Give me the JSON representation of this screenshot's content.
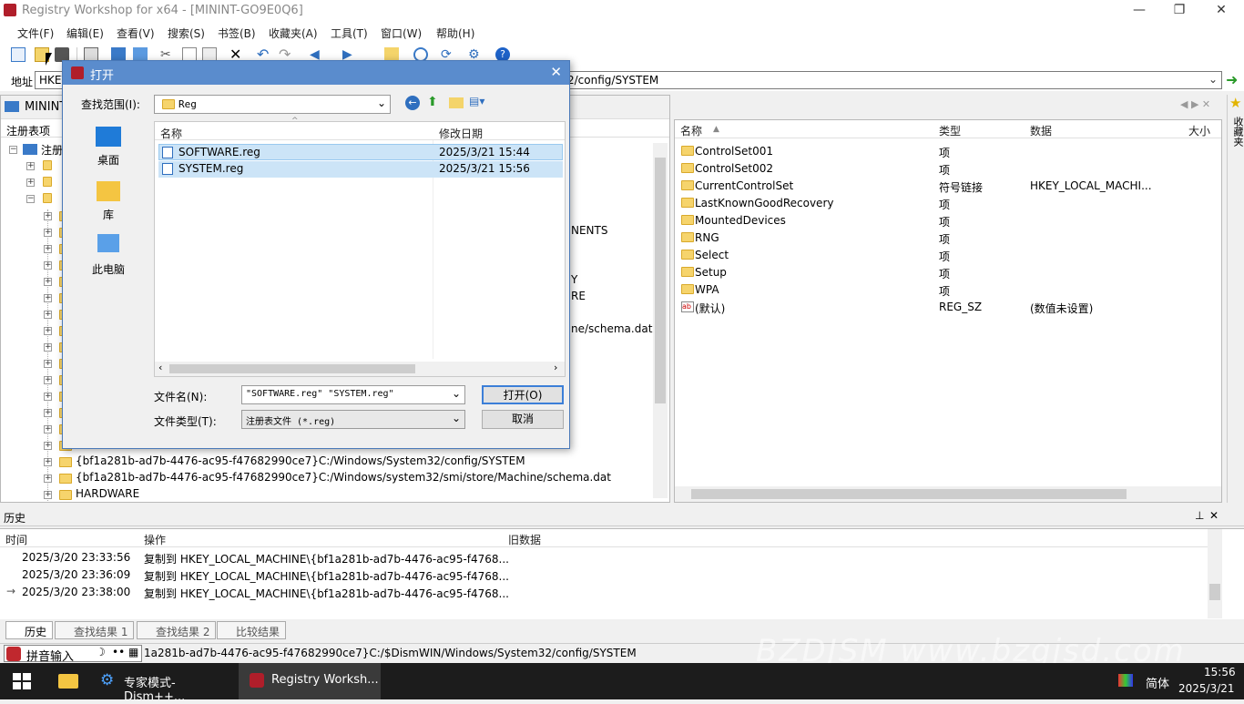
{
  "window": {
    "title": "Registry Workshop for x64 - [MININT-GO9E0Q6]",
    "min": "—",
    "max": "❐",
    "close": "✕"
  },
  "menu": [
    "文件(F)",
    "编辑(E)",
    "查看(V)",
    "搜索(S)",
    "书签(B)",
    "收藏夹(A)",
    "工具(T)",
    "窗口(W)",
    "帮助(H)"
  ],
  "address": {
    "label": "地址",
    "value_start": "HKEY",
    "value_end": "2/config/SYSTEM"
  },
  "left_pane": {
    "tab": "MININT",
    "col_header": "注册表项",
    "root_label": "注册",
    "partial_texts": [
      "NENTS",
      "Y",
      "RE",
      "ne/schema.dat"
    ],
    "rows": [
      "{bf1a281b-ad7b-4476-ac95-f47682990ce7}C:/Windows/System32/config/SYSTEM",
      "{bf1a281b-ad7b-4476-ac95-f47682990ce7}C:/Windows/system32/smi/store/Machine/schema.dat",
      "HARDWARE"
    ]
  },
  "right_pane": {
    "columns": [
      "名称",
      "类型",
      "数据",
      "大小"
    ],
    "rows": [
      {
        "name": "ControlSet001",
        "type": "项",
        "data": ""
      },
      {
        "name": "ControlSet002",
        "type": "项",
        "data": ""
      },
      {
        "name": "CurrentControlSet",
        "type": "符号链接",
        "data": "HKEY_LOCAL_MACHI..."
      },
      {
        "name": "LastKnownGoodRecovery",
        "type": "项",
        "data": ""
      },
      {
        "name": "MountedDevices",
        "type": "项",
        "data": ""
      },
      {
        "name": "RNG",
        "type": "项",
        "data": ""
      },
      {
        "name": "Select",
        "type": "项",
        "data": ""
      },
      {
        "name": "Setup",
        "type": "项",
        "data": ""
      },
      {
        "name": "WPA",
        "type": "项",
        "data": ""
      },
      {
        "name": "(默认)",
        "type": "REG_SZ",
        "data": "(数值未设置)"
      }
    ],
    "fav_label": "收藏夹"
  },
  "history": {
    "title": "历史",
    "columns": [
      "时间",
      "操作",
      "旧数据"
    ],
    "rows": [
      {
        "time": "2025/3/20 23:33:56",
        "op": "复制到 HKEY_LOCAL_MACHINE\\{bf1a281b-ad7b-4476-ac95-f4768..."
      },
      {
        "time": "2025/3/20 23:36:09",
        "op": "复制到 HKEY_LOCAL_MACHINE\\{bf1a281b-ad7b-4476-ac95-f4768..."
      },
      {
        "time": "2025/3/20 23:38:00",
        "op": "复制到 HKEY_LOCAL_MACHINE\\{bf1a281b-ad7b-4476-ac95-f4768..."
      }
    ]
  },
  "bottom_tabs": [
    "历史",
    "查找结果 1",
    "查找结果 2",
    "比较结果"
  ],
  "status": {
    "ime": "拼音输入",
    "path": "1a281b-ad7b-4476-ac95-f47682990ce7}C:/$DismWIN/Windows/System32/config/SYSTEM",
    "watermark": "BZDJSM www.bzgjsd.com"
  },
  "taskbar": {
    "items": [
      "专家模式-Dism++...",
      "Registry Worksh..."
    ],
    "lang": "简体",
    "time": "15:56",
    "date": "2025/3/21"
  },
  "dialog": {
    "title": "打开",
    "look_in_label": "查找范围(I):",
    "look_in_value": "Reg",
    "places": [
      "桌面",
      "库",
      "此电脑"
    ],
    "columns": [
      "名称",
      "修改日期"
    ],
    "files": [
      {
        "name": "SOFTWARE.reg",
        "date": "2025/3/21 15:44"
      },
      {
        "name": "SYSTEM.reg",
        "date": "2025/3/21 15:56"
      }
    ],
    "filename_label": "文件名(N):",
    "filename_value": "\"SOFTWARE.reg\" \"SYSTEM.reg\"",
    "filetype_label": "文件类型(T):",
    "filetype_value": "注册表文件 (*.reg)",
    "open_button": "打开(O)",
    "cancel_button": "取消"
  }
}
